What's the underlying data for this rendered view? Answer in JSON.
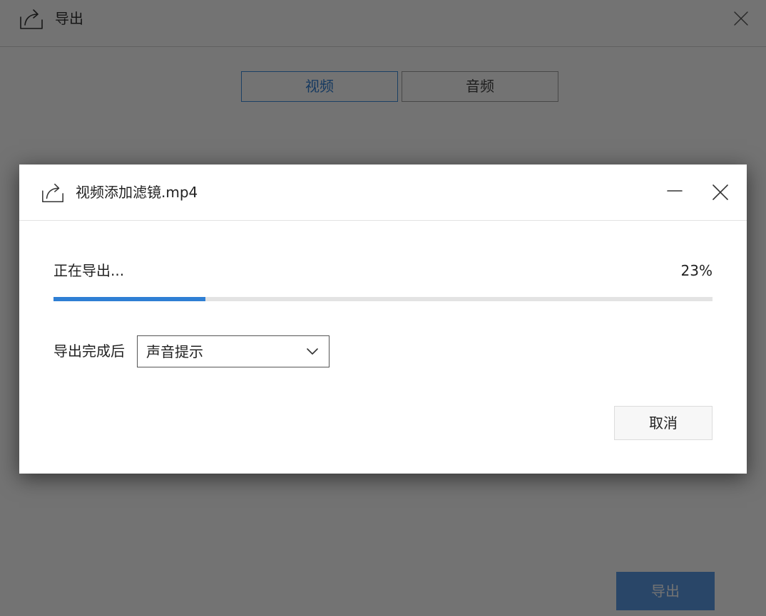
{
  "background_window": {
    "title": "导出",
    "tabs": [
      {
        "label": "视频",
        "selected": true
      },
      {
        "label": "音频",
        "selected": false
      }
    ],
    "export_button_label": "导出",
    "icons": {
      "title": "share-export-icon",
      "close": "close-icon"
    }
  },
  "dialog": {
    "title": "视频添加滤镜.mp4",
    "status_text": "正在导出...",
    "progress": {
      "percent_label": "23%",
      "value": 0.23
    },
    "after_export": {
      "label": "导出完成后",
      "selected_option": "声音提示"
    },
    "cancel_label": "取消",
    "icons": {
      "title": "share-export-icon",
      "minimize": "minimize-icon",
      "close": "close-icon",
      "dropdown": "chevron-down-icon"
    }
  },
  "colors": {
    "accent": "#2f7fd4",
    "progress_track": "#e3e3e3",
    "export_button": "#5b9be6",
    "overlay": "rgba(0,0,0,0.55)"
  }
}
